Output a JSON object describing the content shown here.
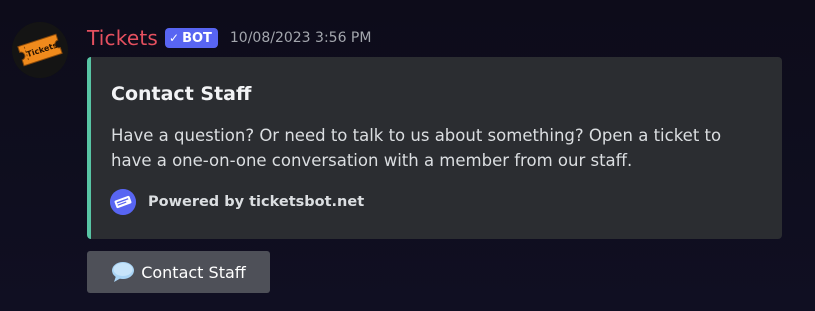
{
  "message": {
    "author": {
      "name": "Tickets",
      "name_color": "#e5505f",
      "avatar_text": "Tickets",
      "avatar_icon": "ticket-icon"
    },
    "bot_tag": {
      "check": "✓",
      "label": "BOT",
      "color": "#5865f2"
    },
    "timestamp": "10/08/2023 3:56 PM"
  },
  "embed": {
    "accent_color": "#58c4a4",
    "title": "Contact Staff",
    "description": "Have a question? Or need to talk to us about something? Open a ticket to have a one-on-one conversation with a member from our staff.",
    "footer": {
      "icon": "tickets-logo-icon",
      "text": "Powered by ticketsbot.net"
    }
  },
  "button": {
    "icon": "speech-balloon-icon",
    "label": "Contact Staff"
  }
}
